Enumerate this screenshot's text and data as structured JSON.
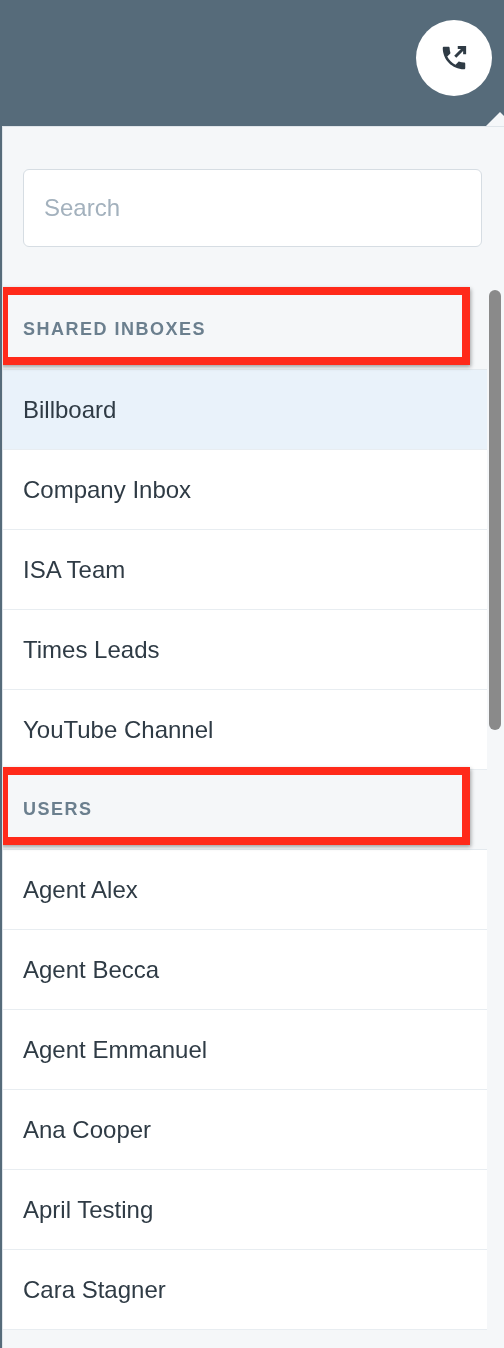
{
  "search": {
    "placeholder": "Search"
  },
  "sections": [
    {
      "title": "SHARED INBOXES",
      "highlighted": true,
      "items": [
        {
          "label": "Billboard",
          "selected": true
        },
        {
          "label": "Company Inbox",
          "selected": false
        },
        {
          "label": "ISA Team",
          "selected": false
        },
        {
          "label": "Times Leads",
          "selected": false
        },
        {
          "label": "YouTube Channel",
          "selected": false
        }
      ]
    },
    {
      "title": "USERS",
      "highlighted": true,
      "items": [
        {
          "label": "Agent Alex",
          "selected": false
        },
        {
          "label": "Agent Becca",
          "selected": false
        },
        {
          "label": "Agent Emmanuel",
          "selected": false
        },
        {
          "label": "Ana Cooper",
          "selected": false
        },
        {
          "label": "April Testing",
          "selected": false
        },
        {
          "label": "Cara Stagner",
          "selected": false
        }
      ]
    }
  ]
}
